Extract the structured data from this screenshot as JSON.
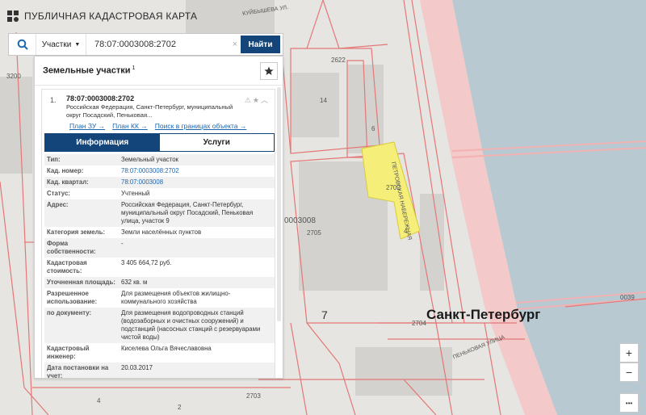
{
  "header": {
    "title": "ПУБЛИЧНАЯ КАДАСТРОВАЯ КАРТА"
  },
  "search": {
    "type_label": "Участки",
    "query": "78:07:0003008:2702",
    "find_label": "Найти"
  },
  "panel": {
    "title": "Земельные участки",
    "count": "1",
    "entry": {
      "index": "1.",
      "cad_number": "78:07:0003008:2702",
      "address_preview": "Российская Федерация, Санкт-Петербург, муниципальный округ Посадский, Пеньковая...",
      "links": [
        "План ЗУ →",
        "План КК →",
        "Поиск в границах объекта →"
      ],
      "tabs": [
        "Информация",
        "Услуги"
      ],
      "rows": [
        {
          "k": "Тип:",
          "v": "Земельный участок"
        },
        {
          "k": "Кад. номер:",
          "v": "78:07:0003008:2702"
        },
        {
          "k": "Кад. квартал:",
          "v": "78:07:0003008"
        },
        {
          "k": "Статус:",
          "v": "Учтенный"
        },
        {
          "k": "Адрес:",
          "v": "Российская Федерация, Санкт-Петербург, муниципальный округ Посадский, Пеньковая улица, участок 9"
        },
        {
          "k": "Категория земель:",
          "v": "Земли населённых пунктов"
        },
        {
          "k": "Форма собственности:",
          "v": "-"
        },
        {
          "k": "Кадастровая стоимость:",
          "v": "3 405 664,72 руб."
        },
        {
          "k": "Уточненная площадь:",
          "v": "632 кв. м"
        },
        {
          "k": "Разрешенное использование:",
          "v": "Для размещения объектов жилищно-коммунального хозяйства"
        },
        {
          "k": "по документу:",
          "v": "Для размещения водопроводных станций (водозаборных и очистных сооружений) и подстанций (насосных станций с резервуарами чистой воды)"
        },
        {
          "k": "Кадастровый инженер:",
          "v": "Киселева Ольга Вячеславовна"
        },
        {
          "k": "Дата постановки на учет:",
          "v": "20.03.2017"
        }
      ]
    }
  },
  "map": {
    "city_label": "Санкт-Петербург",
    "labels": [
      "3200",
      "2622",
      "14",
      "6",
      "2702",
      "4",
      "2705",
      "0003008",
      "7",
      "2704",
      "2703",
      "4",
      "2",
      "0039",
      "ПЕТРОВСКАЯ НАБЕРЕЖНАЯ",
      "ПЕНЬКОВАЯ УЛИЦА",
      "КУЙБЫШЕВА УЛ."
    ]
  },
  "controls": {
    "zoom_in": "+",
    "zoom_out": "−",
    "more": "•••"
  },
  "colors": {
    "accent": "#13447a",
    "link": "#1c67b0",
    "parcel_fill": "#f6f07a",
    "boundary": "#e87a7a",
    "water": "#b7c9d2"
  }
}
